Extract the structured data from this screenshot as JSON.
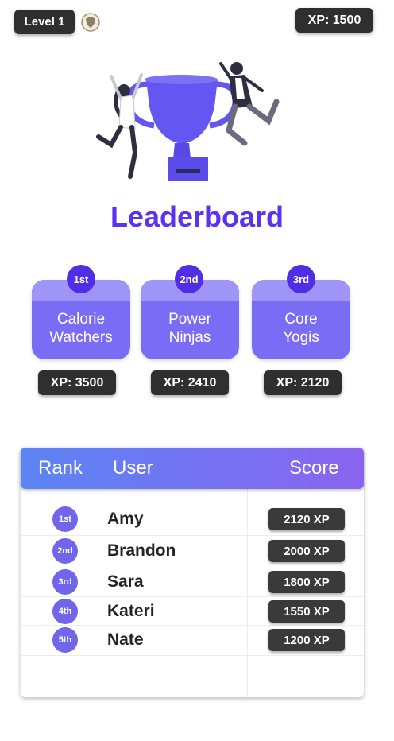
{
  "header": {
    "level_label": "Level 1",
    "xp_label": "XP: 1500"
  },
  "title": "Leaderboard",
  "top_teams": [
    {
      "place": "1st",
      "name_line1": "Calorie",
      "name_line2": "Watchers",
      "xp": "XP: 3500"
    },
    {
      "place": "2nd",
      "name_line1": "Power",
      "name_line2": "Ninjas",
      "xp": "XP: 2410"
    },
    {
      "place": "3rd",
      "name_line1": "Core",
      "name_line2": "Yogis",
      "xp": "XP: 2120"
    }
  ],
  "table": {
    "columns": [
      "Rank",
      "User",
      "Score"
    ],
    "rows": [
      {
        "rank": "1st",
        "user": "Amy",
        "score": "2120 XP"
      },
      {
        "rank": "2nd",
        "user": "Brandon",
        "score": "2000 XP"
      },
      {
        "rank": "3rd",
        "user": "Sara",
        "score": "1800 XP"
      },
      {
        "rank": "4th",
        "user": "Kateri",
        "score": "1550 XP"
      },
      {
        "rank": "5th",
        "user": "Nate",
        "score": "1200 XP"
      }
    ]
  },
  "colors": {
    "accent": "#5b32f0",
    "card": "#7a6cf4",
    "chip": "#2f2f2f"
  },
  "icons": [
    "shield-badge-icon",
    "trophy-illustration"
  ]
}
